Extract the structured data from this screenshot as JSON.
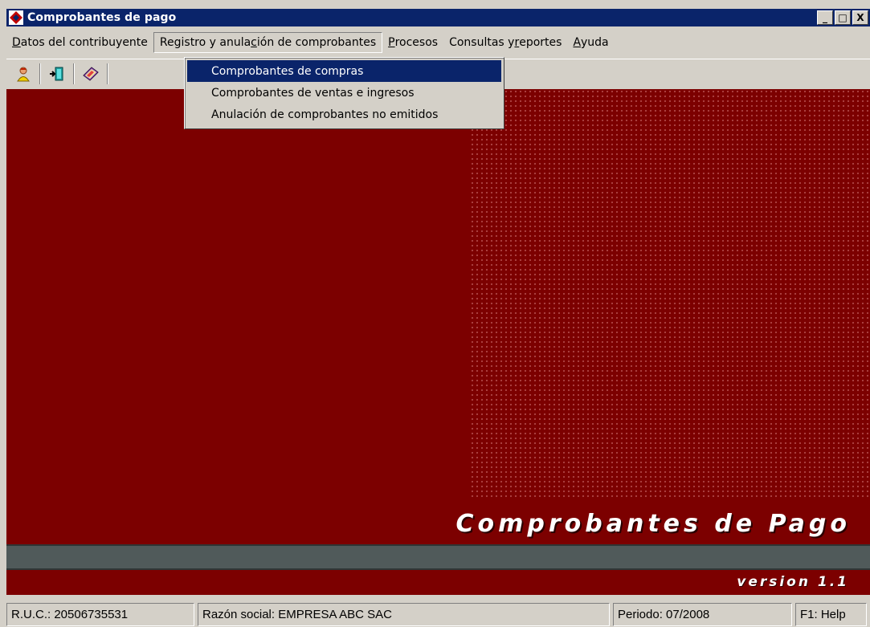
{
  "window": {
    "title": "Comprobantes de pago",
    "buttons": {
      "minimize": "_",
      "maximize": "□",
      "close": "X"
    }
  },
  "menubar": {
    "items": [
      {
        "label": "Datos del contribuyente",
        "accel": "D"
      },
      {
        "label": "Registro y anulación de comprobantes",
        "accel": "c"
      },
      {
        "label": "Procesos",
        "accel": "P"
      },
      {
        "label": "Consultas y reportes",
        "accel": "r"
      },
      {
        "label": "Ayuda",
        "accel": "A"
      }
    ]
  },
  "toolbar": {
    "buttons": [
      {
        "icon": "user-icon"
      },
      {
        "icon": "exit-door-icon"
      },
      {
        "icon": "book-icon"
      }
    ]
  },
  "dropdown": {
    "items": [
      {
        "label": "Comprobantes de compras",
        "selected": true
      },
      {
        "label": "Comprobantes de ventas e ingresos",
        "selected": false
      },
      {
        "label": "Anulación de comprobantes no emitidos",
        "selected": false
      }
    ]
  },
  "brand": {
    "title": "Comprobantes de Pago",
    "version": "version 1.1"
  },
  "statusbar": {
    "ruc": "R.U.C.: 20506735531",
    "razon_social": "Razón social: EMPRESA ABC SAC",
    "periodo": "Periodo: 07/2008",
    "help": "F1: Help"
  },
  "colors": {
    "titlebar": "#0a246a",
    "client_background": "#7c0000",
    "brand_bar": "#505a5a",
    "menu_highlight": "#0a246a"
  }
}
